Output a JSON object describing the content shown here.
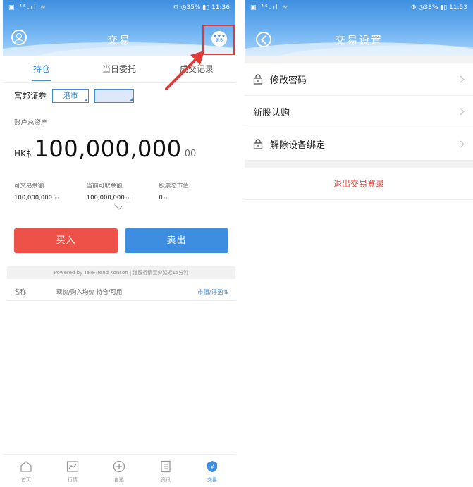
{
  "left_screen": {
    "status_bar": {
      "left": "▣ ⁴⁶.ıl ≋",
      "right": "⚙ ◷35% ▮▯ 11:36"
    },
    "header": {
      "title": "交易",
      "more_label": "更多",
      "more_dots": "•••"
    },
    "tabs": [
      {
        "label": "持仓",
        "active": true
      },
      {
        "label": "当日委托",
        "active": false
      },
      {
        "label": "成交记录",
        "active": false
      }
    ],
    "broker": {
      "name": "富邦证券",
      "market": "港市",
      "account": ""
    },
    "assets": {
      "label": "账户总资产",
      "currency": "HK$",
      "integer": "100,000,000",
      "decimal": ".00"
    },
    "stats": [
      {
        "label": "可交易余额",
        "value": "100,000,000",
        "decimal": ".00"
      },
      {
        "label": "当前可取余额",
        "value": "100,000,000",
        "decimal": ".00"
      },
      {
        "label": "股票总市值",
        "value": "0",
        "decimal": ".00"
      }
    ],
    "buy_label": "买入",
    "sell_label": "卖出",
    "powered_text": "Powered by Tele-Trend Konson | 港股行情至少延迟15分钟",
    "list_header": {
      "name": "名称",
      "middle": "现价/购入均价  持仓/可用",
      "right": "市值/浮盈⇅"
    },
    "bottom_nav": [
      {
        "label": "首页",
        "icon": "home-icon",
        "active": false
      },
      {
        "label": "行情",
        "icon": "chart-icon",
        "active": false
      },
      {
        "label": "自选",
        "icon": "plus-circle-icon",
        "active": false
      },
      {
        "label": "资讯",
        "icon": "news-icon",
        "active": false
      },
      {
        "label": "交易",
        "icon": "trade-icon",
        "active": true
      }
    ]
  },
  "right_screen": {
    "status_bar": {
      "left": "▣ ⁴⁶.ıl ≋",
      "right": "⚙ ◷33% ▮▯ 11:53"
    },
    "header": {
      "title": "交易设置"
    },
    "items": [
      {
        "label": "修改密码",
        "icon": "lock-icon"
      },
      {
        "label": "新股认购",
        "icon": ""
      },
      {
        "label": "解除设备绑定",
        "icon": "lock-icon"
      }
    ],
    "logout_label": "退出交易登录"
  },
  "colors": {
    "accent": "#3d8ee0",
    "buy": "#ed5148",
    "highlight": "#e03b36"
  }
}
